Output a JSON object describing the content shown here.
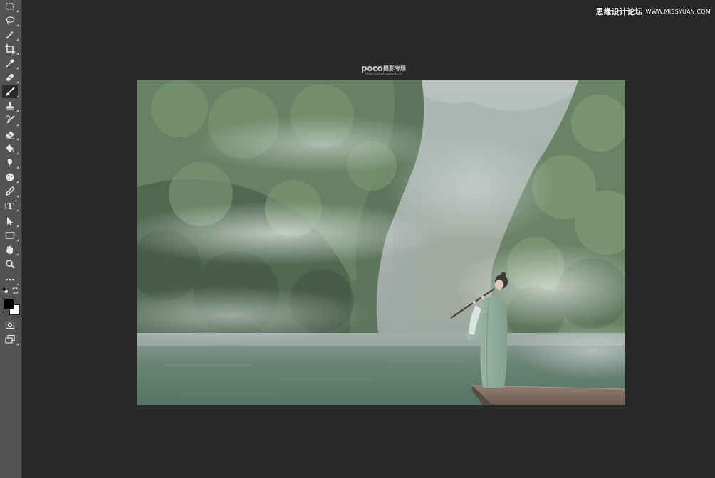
{
  "watermark": {
    "site_name": "思缘设计论坛",
    "site_url": "WWW.MISSYUAN.COM"
  },
  "photo_watermark": {
    "logo": "poco",
    "label": "摄影专题",
    "url": "http://photo.poco.cn/"
  },
  "toolbar": {
    "active_tool": "brush-tool",
    "tools": [
      {
        "name": "rectangular-marquee-tool",
        "icon": "marquee-icon"
      },
      {
        "name": "lasso-tool",
        "icon": "lasso-icon"
      },
      {
        "name": "magic-wand-tool",
        "icon": "magic-wand-icon"
      },
      {
        "name": "crop-tool",
        "icon": "crop-icon"
      },
      {
        "name": "eyedropper-tool",
        "icon": "eyedropper-icon"
      },
      {
        "name": "healing-brush-tool",
        "icon": "bandage-icon"
      },
      {
        "name": "brush-tool",
        "icon": "brush-icon"
      },
      {
        "name": "clone-stamp-tool",
        "icon": "stamp-icon"
      },
      {
        "name": "history-brush-tool",
        "icon": "history-brush-icon"
      },
      {
        "name": "eraser-tool",
        "icon": "eraser-icon"
      },
      {
        "name": "paint-bucket-tool",
        "icon": "paint-bucket-icon"
      },
      {
        "name": "smudge-tool",
        "icon": "smudge-icon"
      },
      {
        "name": "sponge-tool",
        "icon": "sponge-icon"
      },
      {
        "name": "pen-tool",
        "icon": "pen-icon"
      },
      {
        "name": "type-tool",
        "icon": "type-icon"
      },
      {
        "name": "path-selection-tool",
        "icon": "arrow-icon"
      },
      {
        "name": "rectangle-tool",
        "icon": "rectangle-icon"
      },
      {
        "name": "hand-tool",
        "icon": "hand-icon"
      },
      {
        "name": "zoom-tool",
        "icon": "zoom-icon"
      },
      {
        "name": "edit-toolbar",
        "icon": "more-icon"
      }
    ],
    "type_glyph": "T",
    "foreground_color": "#000000",
    "background_color": "#ffffff"
  },
  "colors": {
    "workspace": "#282828",
    "toolbar": "#535353",
    "active_tool": "#2b2b2b"
  }
}
